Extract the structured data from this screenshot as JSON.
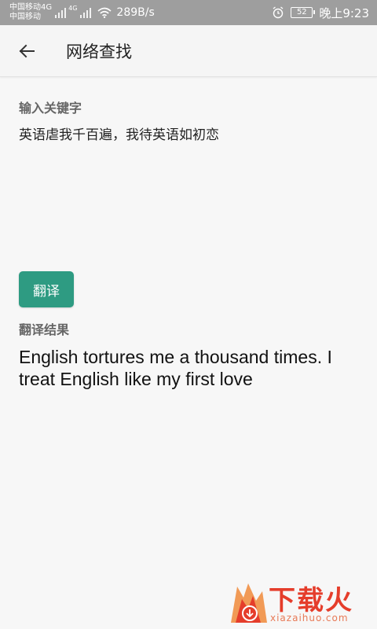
{
  "status_bar": {
    "carrier_1": "中国移动4G",
    "carrier_2": "中国移动",
    "network_tag": "4G",
    "net_speed": "289B/s",
    "battery": "52",
    "time": "晚上9:23"
  },
  "app_bar": {
    "title": "网络查找",
    "back_icon": "arrow-left-icon"
  },
  "main": {
    "input_label": "输入关键字",
    "query": "英语虐我千百遍，我待英语如初恋",
    "translate_button": "翻译",
    "result_label": "翻译结果",
    "result": "English tortures me a thousand times. I treat English like my first love"
  },
  "watermark": {
    "title": "下载火",
    "domain": "xiazaihuo.com"
  },
  "colors": {
    "status_bar": "#9e9e9e",
    "accent": "#2e9b82",
    "background": "#f7f7f7",
    "watermark": "#e53d2b"
  }
}
